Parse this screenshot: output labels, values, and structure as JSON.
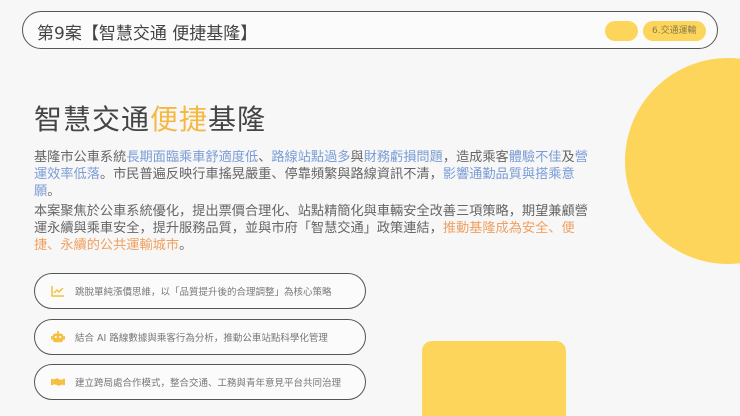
{
  "header": {
    "title": "第9案【智慧交通 便捷基隆】",
    "tag": "6.交通運輸"
  },
  "title": {
    "part1": "智慧交通",
    "part2": "便捷",
    "part3": "基隆"
  },
  "para1": {
    "s1": "基隆市公車系統",
    "s2": "長期面臨乘車舒適度低",
    "s3": "、",
    "s4": "路線站點過多",
    "s5": "與",
    "s6": "財務虧損問題",
    "s7": "，造成乘客",
    "s8": "體驗不佳",
    "s9": "及",
    "s10": "營運效率低落",
    "s11": "。市民普遍反映行車搖晃嚴重、停靠頻繁與路線資訊不清，",
    "s12": "影響通勤品質與搭乘意願",
    "s13": "。"
  },
  "para2": {
    "s1": "本案聚焦於公車系統優化，提出票價合理化、站點精簡化與車輛安全改善三項策略，期望兼顧營運永續與乘車安全，提升服務品質，並與市府「智慧交通」政策連結，",
    "s2": "推動基隆成為安全、便捷、永續的公共運輸城市",
    "s3": "。"
  },
  "cards": [
    {
      "icon": "chart-line-icon",
      "text": "跳脫單純漲價思維，以「品質提升後的合理調整」為核心策略"
    },
    {
      "icon": "robot-icon",
      "text": "結合 AI 路線數據與乘客行為分析，推動公車站點科學化管理"
    },
    {
      "icon": "handshake-icon",
      "text": "建立跨局處合作模式，整合交通、工務與青年意見平台共同治理"
    }
  ],
  "colors": {
    "accent": "#fcd55a",
    "blue": "#7a9cd6",
    "orange": "#f0a060"
  }
}
